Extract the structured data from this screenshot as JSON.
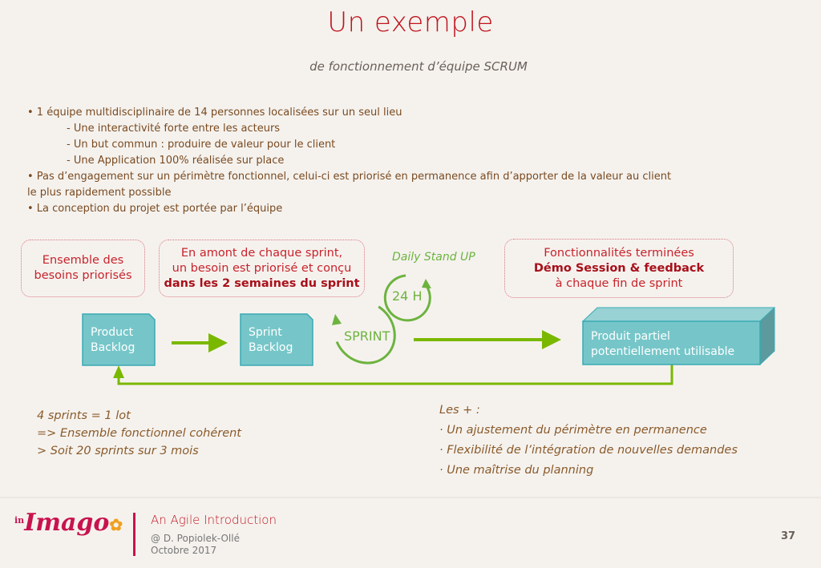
{
  "header": {
    "title": "Un exemple",
    "subtitle": "de fonctionnement d’équipe SCRUM"
  },
  "bullets": [
    {
      "level": 1,
      "text": "• 1 équipe multidisciplinaire de 14 personnes localisées sur un seul lieu"
    },
    {
      "level": 2,
      "text": "- Une interactivité forte entre les acteurs"
    },
    {
      "level": 2,
      "text": "- Un but commun : produire de valeur pour le client"
    },
    {
      "level": 2,
      "text": "- Une Application 100% réalisée sur place"
    },
    {
      "level": 1,
      "text": "• Pas d’engagement sur un périmètre fonctionnel, celui-ci est priorisé en permanence afin d’apporter de la valeur au client"
    },
    {
      "level": 0,
      "text": "le plus rapidement possible"
    },
    {
      "level": 1,
      "text": "• La conception du projet est portée par l’équipe"
    }
  ],
  "diagram": {
    "bubble_backlog": {
      "line1": "Ensemble des",
      "line2": "besoins priorisés"
    },
    "bubble_sprint": {
      "line1": "En amont de chaque sprint,",
      "line2": "un besoin est priorisé et conçu",
      "bold": "dans les 2 semaines du sprint"
    },
    "bubble_demo": {
      "line1": "Fonctionnalités terminées",
      "bold": "Démo Session & feedback",
      "line3": "à chaque fin de sprint"
    },
    "daily_label": "Daily Stand UP",
    "daily_cycle": "24 H",
    "sprint_cycle": "SPRINT",
    "product_backlog": {
      "line1": "Product",
      "line2": "Backlog"
    },
    "sprint_backlog": {
      "line1": "Sprint",
      "line2": "Backlog"
    },
    "product": {
      "line1": "Produit partiel",
      "line2": "potentiellement utilisable"
    },
    "colors": {
      "arrow": "#7ab800",
      "cycle": "#6db33f",
      "box": "#76c6c9",
      "bubble_border": "#d9777c",
      "bubble_text": "#c8232b"
    }
  },
  "notes_left": [
    "4 sprints = 1 lot",
    "=> Ensemble fonctionnel cohérent",
    "> Soit 20 sprints sur 3 mois"
  ],
  "notes_right": {
    "heading": "Les + :",
    "items": [
      "· Un ajustement du périmètre en permanence",
      "· Flexibilité de l’intégration de nouvelles demandes",
      "· Une maîtrise du planning"
    ]
  },
  "footer": {
    "logo_prefix": "in",
    "logo": "Imago",
    "title": "An Agile Introduction",
    "author": "@ D. Popiolek-Ollé",
    "date": "Octobre 2017",
    "page": "37"
  }
}
